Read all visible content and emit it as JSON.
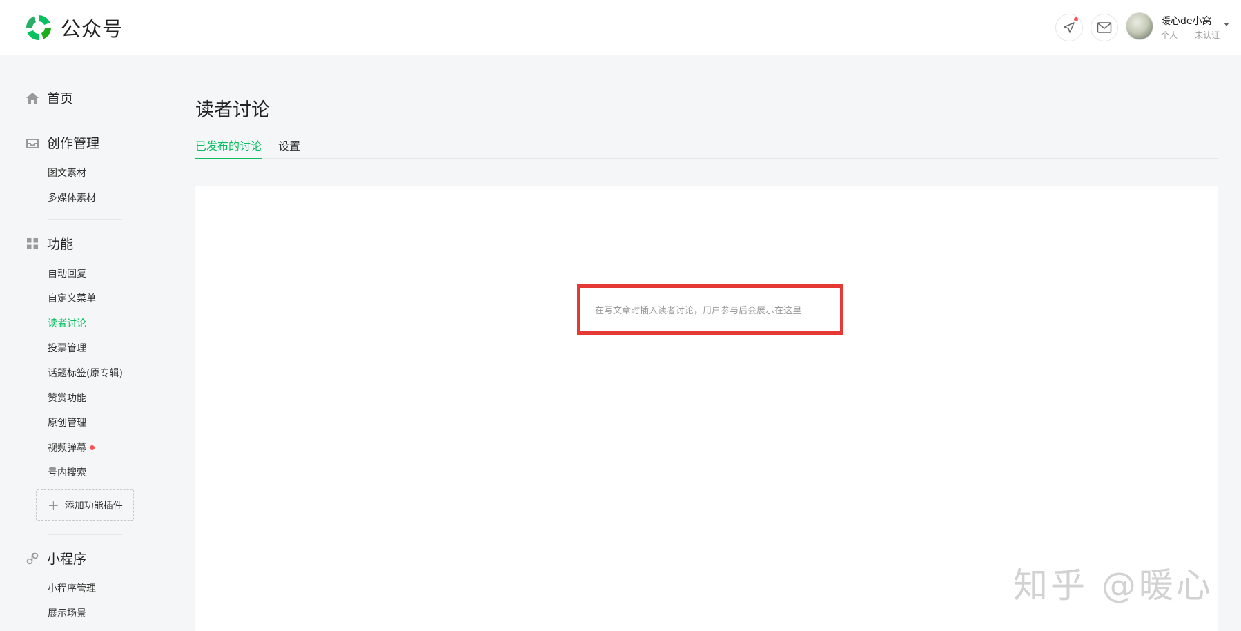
{
  "header": {
    "logo_text": "公众号",
    "user": {
      "name": "暖心de小窝",
      "type": "个人",
      "verify_status": "未认证"
    }
  },
  "sidebar": {
    "home": {
      "label": "首页",
      "icon": "home-icon"
    },
    "creation": {
      "label": "创作管理",
      "icon": "inbox-icon",
      "items": [
        {
          "label": "图文素材"
        },
        {
          "label": "多媒体素材"
        }
      ]
    },
    "features": {
      "label": "功能",
      "icon": "grid-icon",
      "items": [
        {
          "label": "自动回复"
        },
        {
          "label": "自定义菜单"
        },
        {
          "label": "读者讨论",
          "active": true
        },
        {
          "label": "投票管理"
        },
        {
          "label": "话题标签(原专辑)"
        },
        {
          "label": "赞赏功能"
        },
        {
          "label": "原创管理"
        },
        {
          "label": "视频弹幕",
          "badge": true
        },
        {
          "label": "号内搜索"
        }
      ],
      "add_plugin": "添加功能插件"
    },
    "miniprogram": {
      "label": "小程序",
      "icon": "link-icon",
      "items": [
        {
          "label": "小程序管理"
        },
        {
          "label": "展示场景"
        }
      ]
    }
  },
  "main": {
    "title": "读者讨论",
    "tabs": [
      {
        "label": "已发布的讨论",
        "active": true
      },
      {
        "label": "设置"
      }
    ],
    "empty_text": "在写文章时插入读者讨论，用户参与后会展示在这里"
  },
  "watermark": "知乎 @暖心",
  "colors": {
    "accent": "#07c160",
    "highlight_border": "#e53935",
    "badge": "#fa5151"
  }
}
